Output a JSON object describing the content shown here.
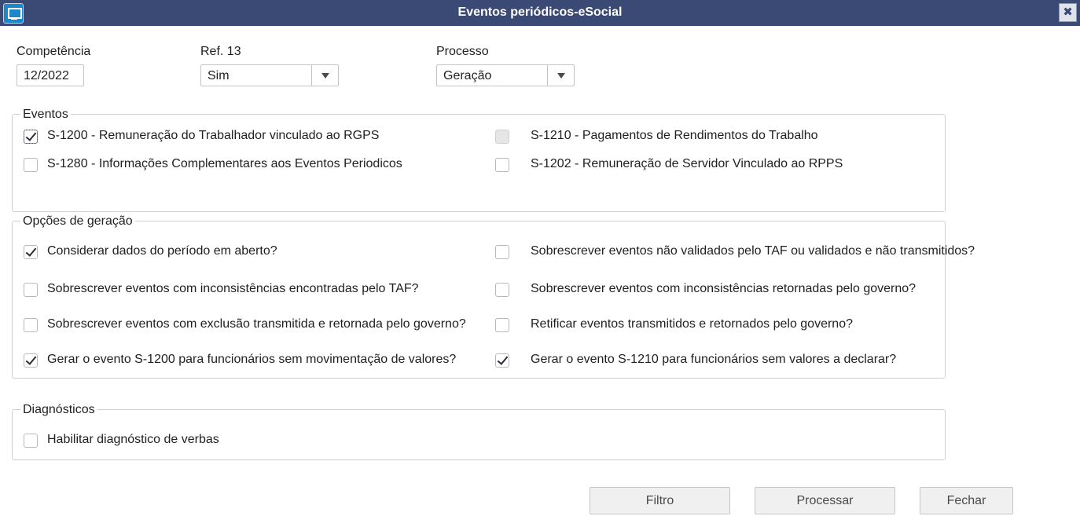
{
  "window": {
    "title": "Eventos periódicos-eSocial",
    "icon": "monitor-icon",
    "close_glyph": "✖"
  },
  "header": {
    "competencia_label": "Competência",
    "competencia_value": "12/2022",
    "ref13_label": "Ref. 13",
    "ref13_value": "Sim",
    "processo_label": "Processo",
    "processo_value": "Geração"
  },
  "eventos": {
    "title": "Eventos",
    "items": [
      {
        "label": "S-1200 - Remuneração do Trabalhador vinculado ao RGPS",
        "checked": true,
        "focused": true,
        "enabled": true
      },
      {
        "label": "S-1210 - Pagamentos de Rendimentos do Trabalho",
        "checked": false,
        "enabled": false
      },
      {
        "label": "S-1280 - Informações Complementares aos Eventos Periodicos",
        "checked": false,
        "enabled": true
      },
      {
        "label": "S-1202 - Remuneração de Servidor Vinculado ao RPPS",
        "checked": false,
        "enabled": true
      }
    ]
  },
  "opcoes": {
    "title": "Opções de geração",
    "items": [
      {
        "label": "Considerar dados do período em aberto?",
        "checked": true
      },
      {
        "label": "Sobrescrever eventos não validados pelo TAF ou validados e não transmitidos?",
        "checked": false
      },
      {
        "label": "Sobrescrever eventos com inconsistências encontradas pelo TAF?",
        "checked": false
      },
      {
        "label": "Sobrescrever eventos com inconsistências retornadas pelo governo?",
        "checked": false
      },
      {
        "label": "Sobrescrever eventos com exclusão transmitida e retornada pelo governo?",
        "checked": false
      },
      {
        "label": "Retificar eventos transmitidos e retornados pelo governo?",
        "checked": false
      },
      {
        "label": "Gerar o evento S-1200 para funcionários sem movimentação de valores?",
        "checked": true
      },
      {
        "label": "Gerar o evento S-1210 para funcionários sem valores a declarar?",
        "checked": true
      }
    ]
  },
  "diagnosticos": {
    "title": "Diagnósticos",
    "items": [
      {
        "label": "Habilitar diagnóstico de verbas",
        "checked": false
      }
    ]
  },
  "buttons": {
    "filtro": "Filtro",
    "processar": "Processar",
    "fechar": "Fechar"
  }
}
